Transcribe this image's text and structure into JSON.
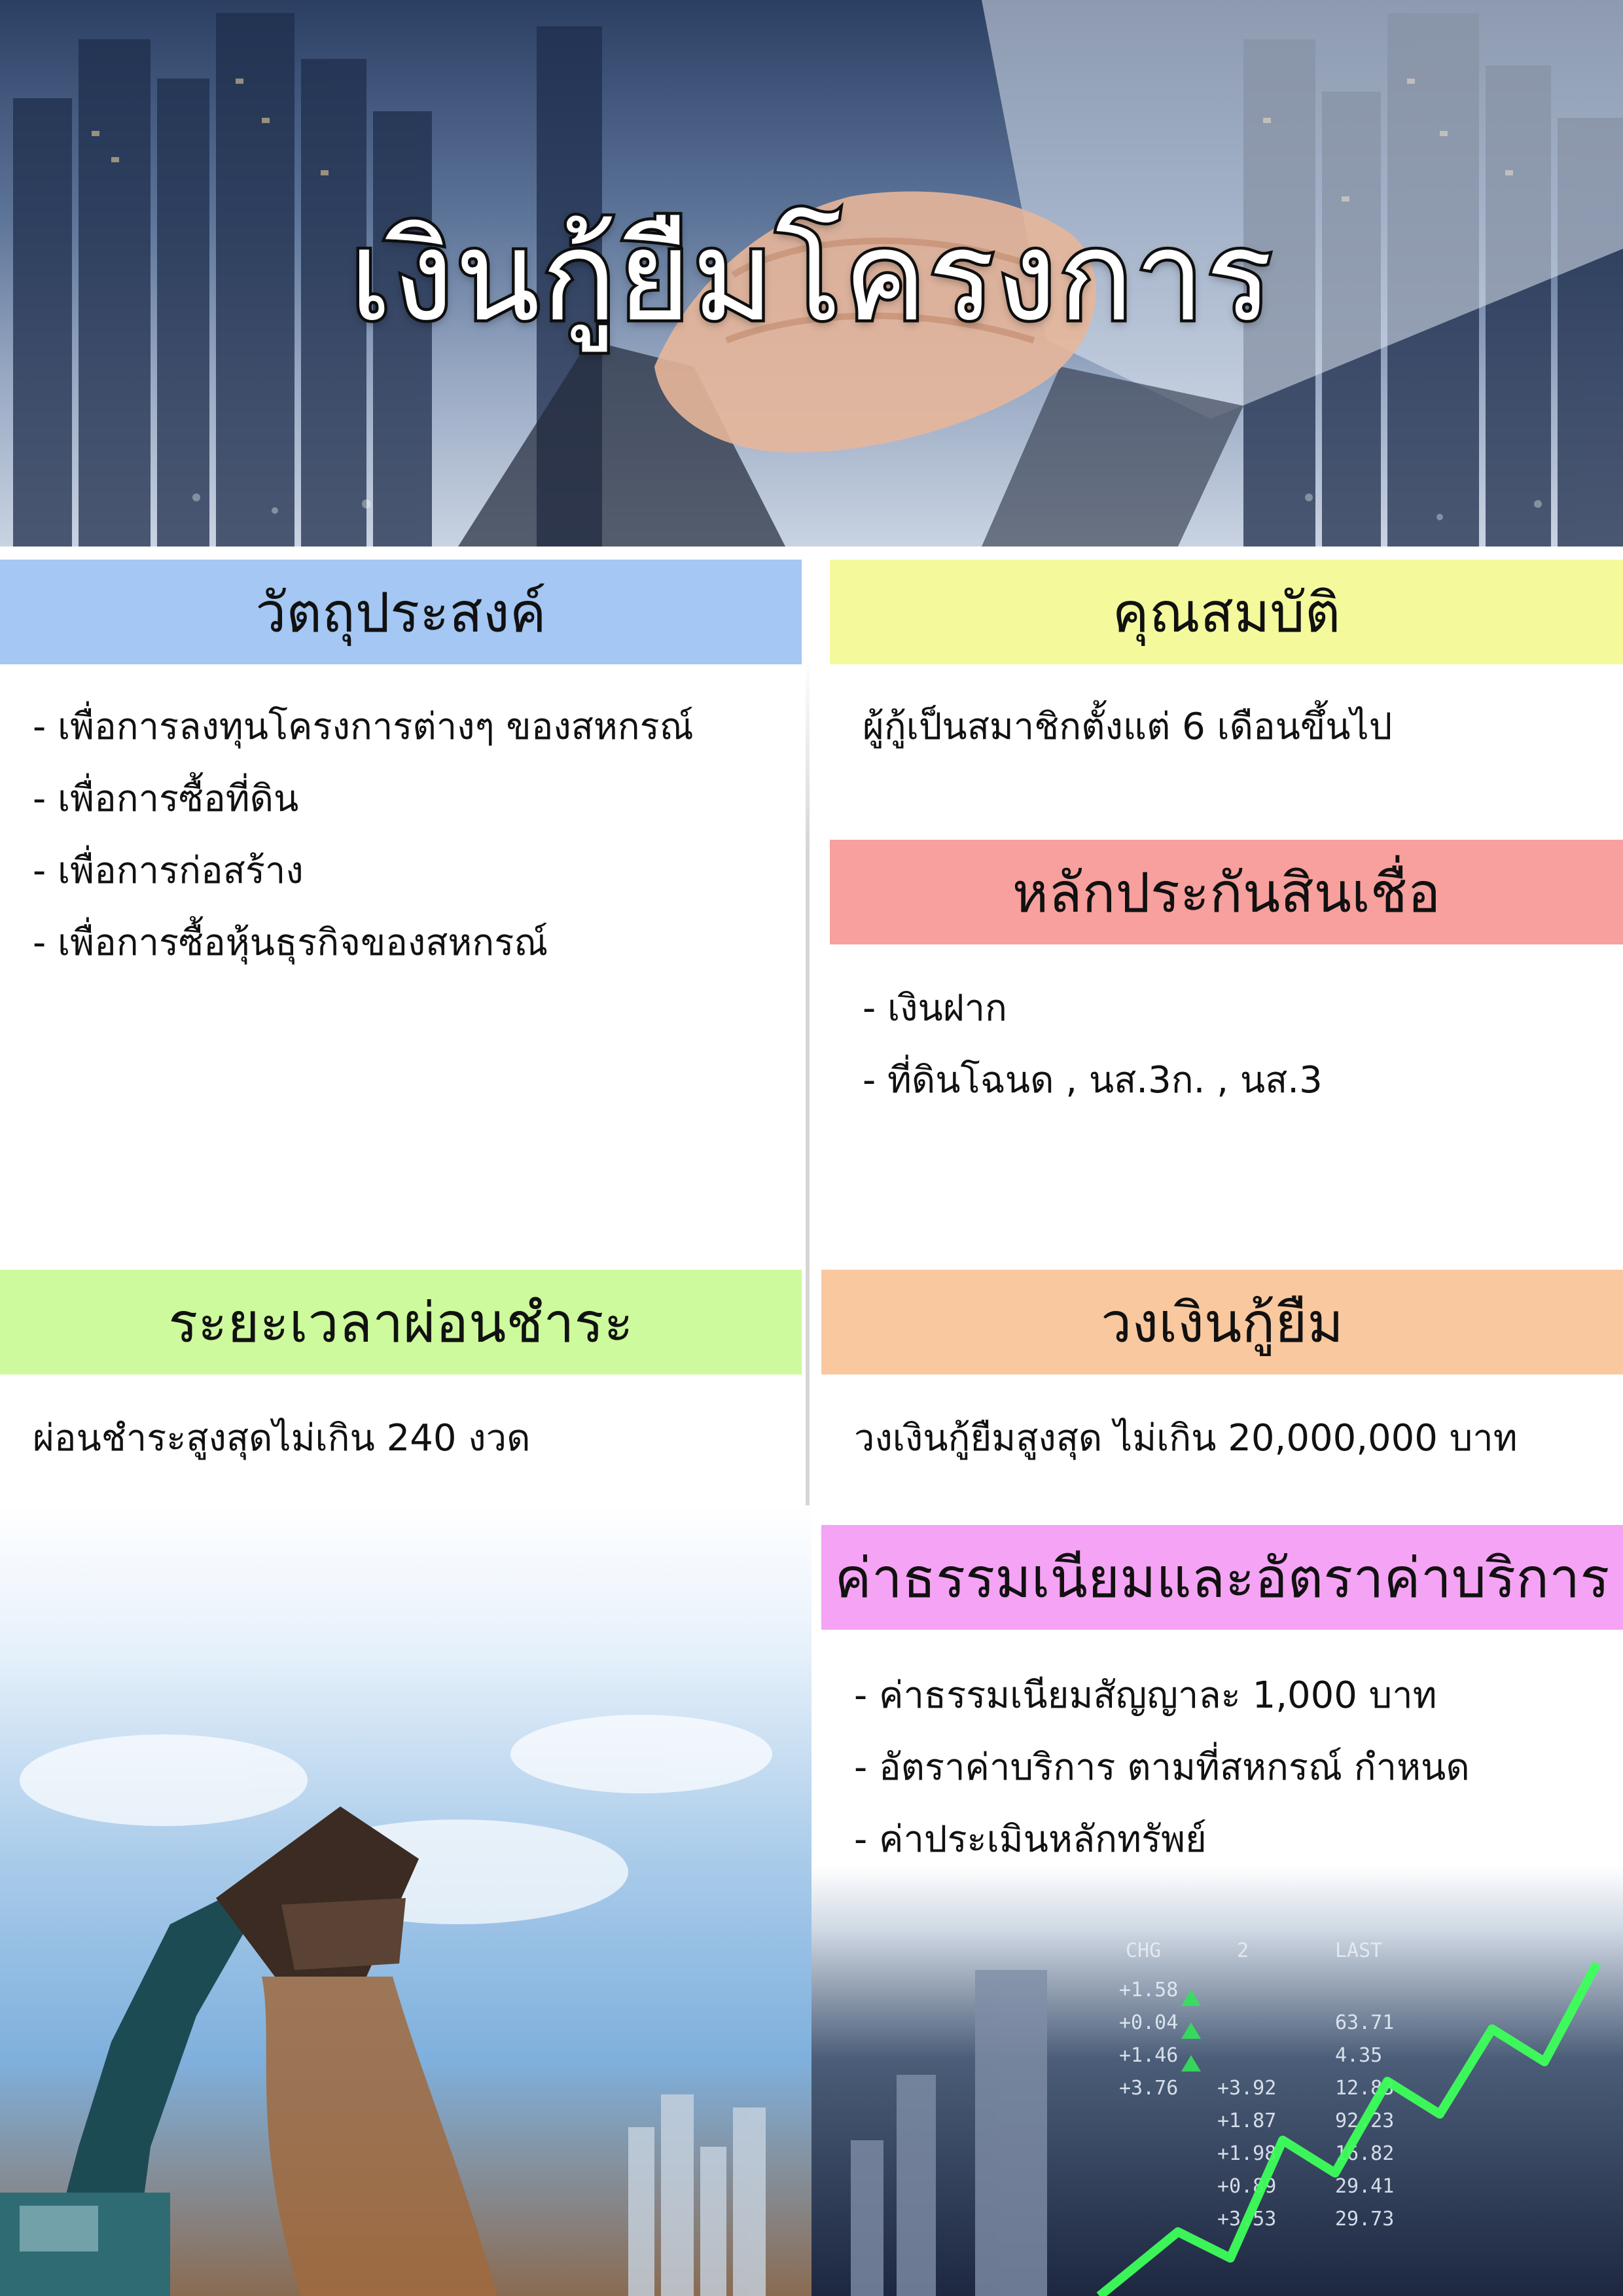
{
  "title": "เงินกู้ยืมโครงการ",
  "sections": {
    "objective": {
      "heading": "วัตถุประสงค์",
      "items": [
        "- เพื่อการลงทุนโครงการต่างๆ ของสหกรณ์",
        "- เพื่อการซื้อที่ดิน",
        "- เพื่อการก่อสร้าง",
        "- เพื่อการซื้อหุ้นธุรกิจของสหกรณ์"
      ]
    },
    "qualification": {
      "heading": "คุณสมบัติ",
      "text": "ผู้กู้เป็นสมาชิกตั้งแต่ 6 เดือนขึ้นไป"
    },
    "collateral": {
      "heading": "หลักประกันสินเชื่อ",
      "items": [
        "- เงินฝาก",
        "- ที่ดินโฉนด , นส.3ก. , นส.3"
      ]
    },
    "repayment": {
      "heading": "ระยะเวลาผ่อนชำระ",
      "text": "ผ่อนชำระสูงสุดไม่เกิน 240 งวด"
    },
    "limit": {
      "heading": "วงเงินกู้ยืม",
      "text": "วงเงินกู้ยืมสูงสุด ไม่เกิน 20,000,000 บาท"
    },
    "fees": {
      "heading": "ค่าธรรมเนียมและอัตราค่าบริการ",
      "items": [
        "- ค่าธรรมเนียมสัญญาละ 1,000 บาท",
        "- อัตราค่าบริการ ตามที่สหกรณ์ กำหนด",
        "- ค่าประเมินหลักทรัพย์"
      ]
    }
  },
  "colors": {
    "objective_bar": "#a4c7f3",
    "qualification_bar": "#f4fa9c",
    "collateral_bar": "#f7a09d",
    "repayment_bar": "#cdfa9c",
    "limit_bar": "#f9c89e",
    "fees_bar": "#f5a3f4"
  },
  "images": {
    "hero": "city-skyline-handshake-photo",
    "bottom_left": "excavator-digging-photo",
    "bottom_right": "stock-chart-growth-photo"
  },
  "stock_board": {
    "header": [
      "CHG",
      "2",
      "LAST"
    ],
    "values": [
      "+1.58",
      "+0.04",
      "+1.46",
      "+3.76",
      "+3.92",
      "+1.87",
      "+1.98",
      "+0.89",
      "+3.53",
      "63.71",
      "4.35",
      "12.83",
      "92.23",
      "16.82",
      "29.41",
      "29.73"
    ]
  }
}
